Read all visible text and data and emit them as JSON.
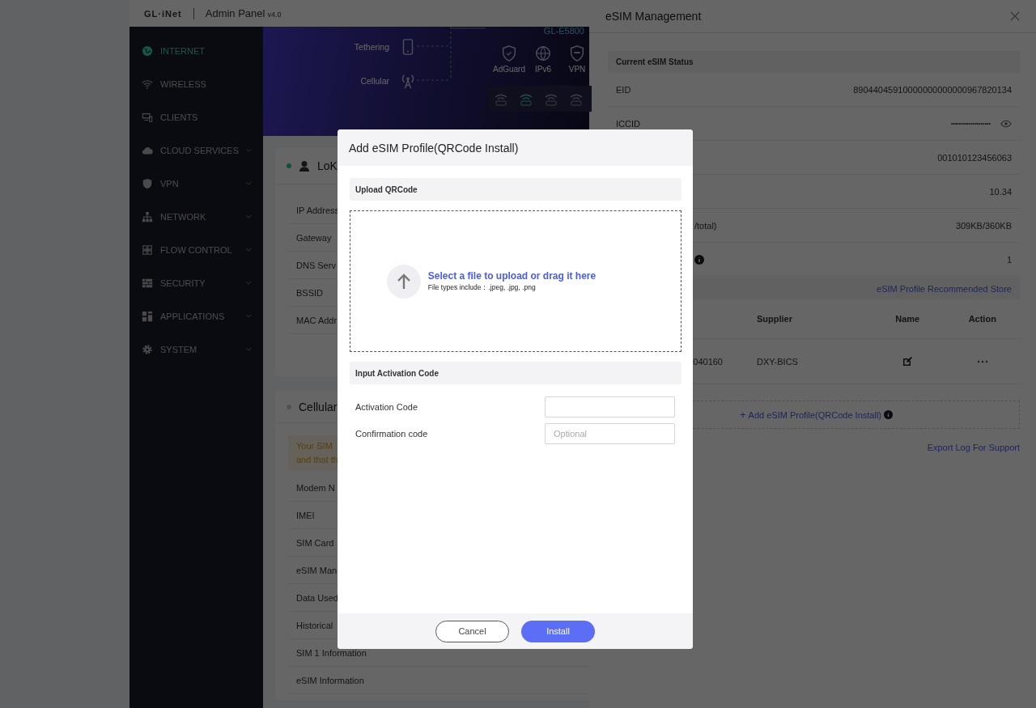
{
  "header": {
    "logo": "GL·iNet",
    "title": "Admin Panel",
    "version": "v4.0"
  },
  "sidebar": {
    "items": [
      {
        "label": "INTERNET",
        "selected": true,
        "expandable": false
      },
      {
        "label": "WIRELESS",
        "selected": false,
        "expandable": false
      },
      {
        "label": "CLIENTS",
        "selected": false,
        "expandable": false
      },
      {
        "label": "CLOUD SERVICES",
        "selected": false,
        "expandable": true
      },
      {
        "label": "VPN",
        "selected": false,
        "expandable": true
      },
      {
        "label": "NETWORK",
        "selected": false,
        "expandable": true
      },
      {
        "label": "FLOW CONTROL",
        "selected": false,
        "expandable": true
      },
      {
        "label": "SECURITY",
        "selected": false,
        "expandable": true
      },
      {
        "label": "APPLICATIONS",
        "selected": false,
        "expandable": true
      },
      {
        "label": "SYSTEM",
        "selected": false,
        "expandable": true
      }
    ]
  },
  "hero": {
    "device": "GL-E5800",
    "sources": [
      {
        "label": "Tethering"
      },
      {
        "label": "Cellular"
      }
    ],
    "features": [
      {
        "label": "AdGuard"
      },
      {
        "label": "IPv6"
      },
      {
        "label": "VPN"
      }
    ],
    "radios": [
      {
        "active": false
      },
      {
        "active": true
      },
      {
        "active": false
      },
      {
        "active": false
      }
    ]
  },
  "network_card": {
    "title": "LoK",
    "connected": true,
    "rows": [
      "IP Address",
      "Gateway",
      "DNS Serv",
      "BSSID",
      "MAC Addr"
    ]
  },
  "cellular_card": {
    "title": "Cellular",
    "connected": false,
    "warning": [
      "Your SIM",
      "and that th"
    ],
    "rows": [
      "Modem N",
      "IMEI",
      "SIM Card",
      "eSIM Man",
      "Data Used",
      "Historical",
      "SIM 1 Information",
      "eSIM Information"
    ]
  },
  "drawer": {
    "title": "eSIM Management",
    "status_title": "Current eSIM Status",
    "rows": [
      {
        "label": "EID",
        "value": "89044045910000000000000967820134"
      },
      {
        "label": "ICCID",
        "value": "••••••••••••••••••••",
        "masked": true
      },
      {
        "value": "001010123456063"
      },
      {
        "value": "10.34"
      },
      {
        "label": "/total)",
        "value": "309KB/360KB"
      },
      {
        "info": true,
        "value": "1"
      }
    ],
    "store_link": "eSIM Profile Recommended Store",
    "columns": [
      "Supplier",
      "Name",
      "Action"
    ],
    "profiles": [
      {
        "id_fragment": "040160",
        "supplier": "DXY-BICS"
      }
    ],
    "add_button": {
      "icon": "+",
      "label": "Add eSIM Profile(QRCode Install)"
    },
    "export_link": "Export Log For Support"
  },
  "modal": {
    "title": "Add eSIM Profile(QRCode Install)",
    "upload_title": "Upload QRCode",
    "dropzone": {
      "prompt": "Select a file to upload or drag it here",
      "hint": "File types include：.jpeg, .jpg, .png"
    },
    "code_title": "Input Activation Code",
    "fields": [
      {
        "label": "Activation Code"
      },
      {
        "label": "Confirmation code",
        "placeholder": "Optional"
      }
    ],
    "buttons": [
      {
        "label": "Cancel",
        "kind": "secondary"
      },
      {
        "label": "Install",
        "kind": "primary"
      }
    ]
  }
}
